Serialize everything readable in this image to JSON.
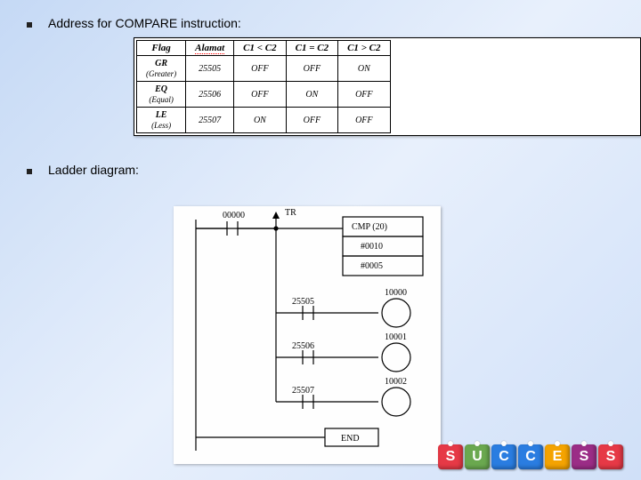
{
  "bullets": {
    "b1": "Address for COMPARE instruction:",
    "b2": "Ladder diagram:"
  },
  "table": {
    "headers": {
      "h1": "Flag",
      "h2": "Alamat",
      "h3": "C1 < C2",
      "h4": "C1 = C2",
      "h5": "C1 > C2"
    },
    "rows": {
      "r1": {
        "name": "GR",
        "sub": "(Greater)",
        "addr": "25505",
        "a": "OFF",
        "b": "OFF",
        "c": "ON"
      },
      "r2": {
        "name": "EQ",
        "sub": "(Equal)",
        "addr": "25506",
        "a": "OFF",
        "b": "ON",
        "c": "OFF"
      },
      "r3": {
        "name": "LE",
        "sub": "(Less)",
        "addr": "25507",
        "a": "ON",
        "b": "OFF",
        "c": "OFF"
      }
    }
  },
  "ladder": {
    "tr": "TR",
    "input": "00000",
    "cmp": "CMP (20)",
    "op1": "#0010",
    "op2": "#0005",
    "rungs": {
      "r1": {
        "contact": "25505",
        "coil": "10000"
      },
      "r2": {
        "contact": "25506",
        "coil": "10001"
      },
      "r3": {
        "contact": "25507",
        "coil": "10002"
      }
    },
    "end": "END"
  },
  "success": {
    "s": "S",
    "u": "U",
    "c1": "C",
    "c2": "C",
    "e": "E",
    "s2": "S",
    "s3": "S"
  },
  "chart_data": {
    "type": "table",
    "title": "Address for COMPARE instruction",
    "columns": [
      "Flag",
      "Alamat",
      "C1 < C2",
      "C1 = C2",
      "C1 > C2"
    ],
    "rows": [
      [
        "GR (Greater)",
        "25505",
        "OFF",
        "OFF",
        "ON"
      ],
      [
        "EQ (Equal)",
        "25506",
        "OFF",
        "ON",
        "OFF"
      ],
      [
        "LE (Less)",
        "25507",
        "ON",
        "OFF",
        "OFF"
      ]
    ]
  }
}
